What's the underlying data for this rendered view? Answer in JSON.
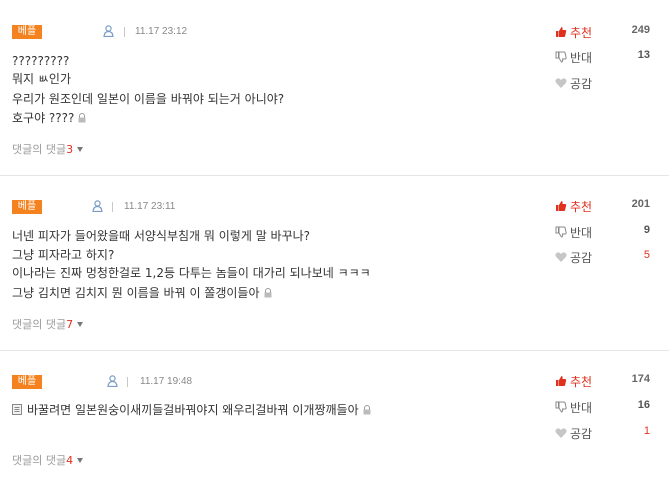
{
  "comments": [
    {
      "badge": "베플",
      "time": "11.17 23:12",
      "lines": [
        "?????????",
        "뭐지 ㅄ인가",
        "우리가 원조인데 일본이 이름을 바꿔야 되는거 아니야?",
        "호구야 ????"
      ],
      "replies_label": "댓글의 댓글",
      "replies_count": "3",
      "recommend": {
        "label": "추천",
        "count": "249"
      },
      "oppose": {
        "label": "반대",
        "count": "13"
      },
      "empathy": {
        "label": "공감",
        "count": ""
      }
    },
    {
      "badge": "베플",
      "time": "11.17 23:11",
      "lines": [
        "너넨 피자가 들어왔을때 서양식부침개 뭐 이렇게 말 바꾸나?",
        "그냥 피자라고 하지?",
        "이나라는 진짜 멍청한걸로 1,2등 다투는 놈들이 대가리 되나보네 ㅋㅋㅋ",
        "그냥 김치면 김치지 뭔 이름을 바꿔 이 쫄갱이들아"
      ],
      "replies_label": "댓글의 댓글",
      "replies_count": "7",
      "recommend": {
        "label": "추천",
        "count": "201"
      },
      "oppose": {
        "label": "반대",
        "count": "9"
      },
      "empathy": {
        "label": "공감",
        "count": "5"
      }
    },
    {
      "badge": "베플",
      "time": "11.17 19:48",
      "lines": [
        "바꿀려면 일본원숭이새끼들걸바꿔야지 왜우리걸바꿔 이개짱깨들아"
      ],
      "replies_label": "댓글의 댓글",
      "replies_count": "4",
      "recommend": {
        "label": "추천",
        "count": "174"
      },
      "oppose": {
        "label": "반대",
        "count": "16"
      },
      "empathy": {
        "label": "공감",
        "count": "1"
      }
    }
  ],
  "icons": {
    "user": "user-icon",
    "recommend": "thumb-up-icon",
    "oppose": "thumb-down-icon",
    "empathy": "heart-icon",
    "lock": "lock-icon",
    "reply_toggle": "caret-down-icon"
  },
  "colors": {
    "badge": "#f4821f",
    "accent": "#e0301e"
  }
}
